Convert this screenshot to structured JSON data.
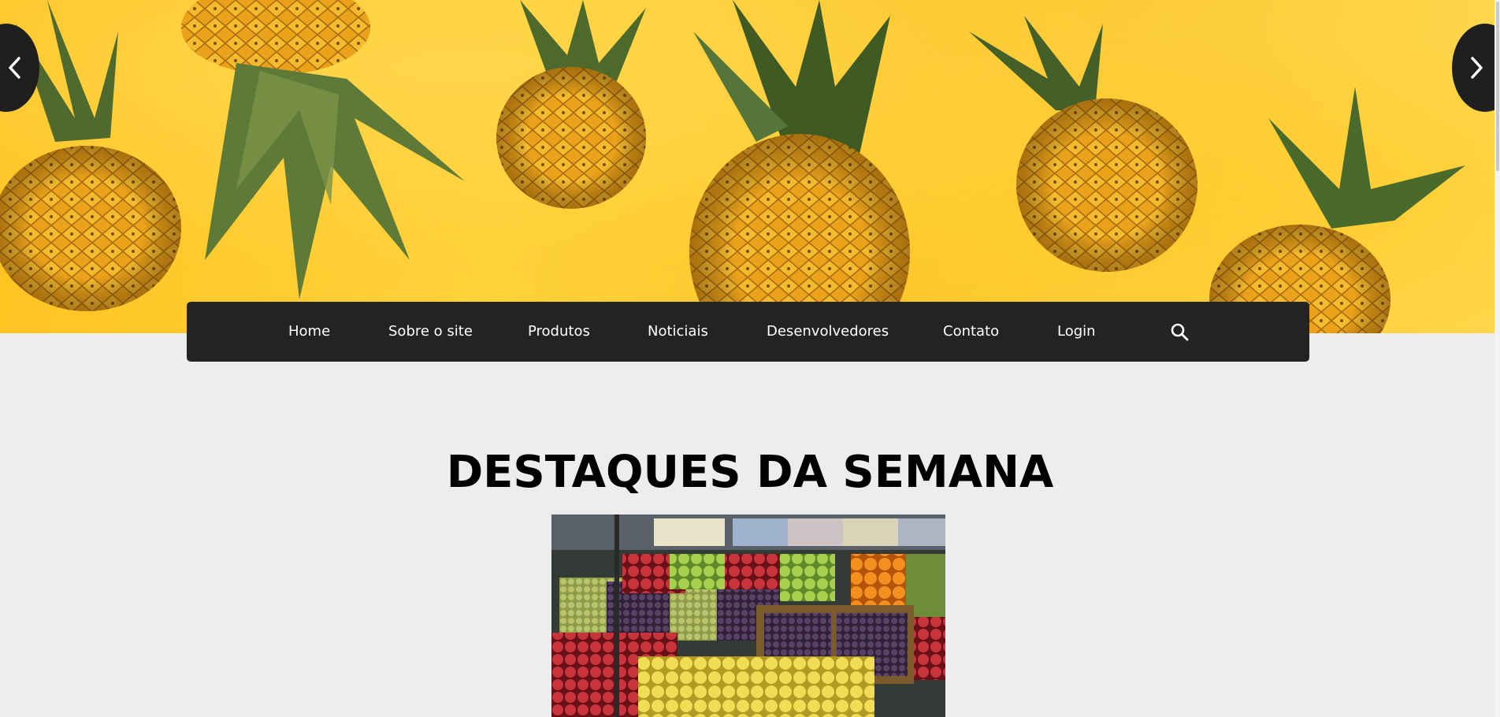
{
  "nav": {
    "items": [
      {
        "label": "Home"
      },
      {
        "label": "Sobre o site"
      },
      {
        "label": "Produtos"
      },
      {
        "label": "Noticiais"
      },
      {
        "label": "Desenvolvedores"
      },
      {
        "label": "Contato"
      },
      {
        "label": "Login"
      }
    ],
    "search_icon": "search-icon"
  },
  "carousel": {
    "prev_icon": "chevron-left-icon",
    "next_icon": "chevron-right-icon"
  },
  "main": {
    "title": "DESTAQUES DA SEMANA"
  },
  "colors": {
    "nav_bg": "#232323",
    "page_bg": "#ededed",
    "hero_yellow": "#ffc21f",
    "title": "#000000"
  }
}
